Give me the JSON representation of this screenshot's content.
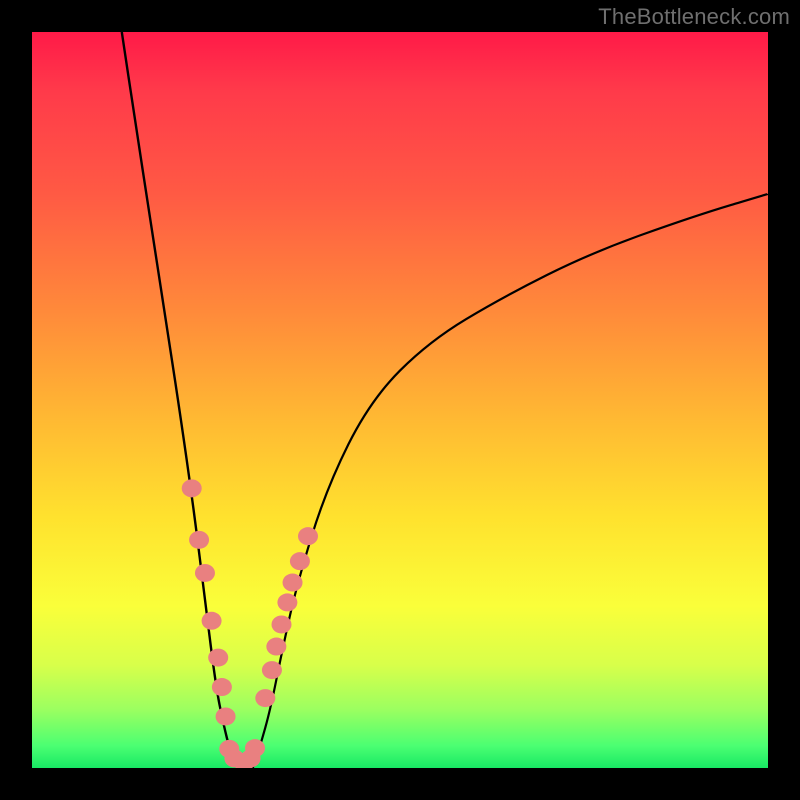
{
  "watermark": "TheBottleneck.com",
  "chart_data": {
    "type": "line",
    "title": "",
    "xlabel": "",
    "ylabel": "",
    "xlim": [
      0,
      100
    ],
    "ylim": [
      0,
      100
    ],
    "grid": false,
    "series": [
      {
        "name": "left-branch",
        "x": [
          12.2,
          14,
          16,
          18,
          20,
          22,
          23.6,
          25,
          26,
          27,
          28
        ],
        "y": [
          100,
          88,
          75,
          62,
          49,
          35,
          22,
          11,
          6,
          2,
          0
        ]
      },
      {
        "name": "right-branch",
        "x": [
          30,
          31,
          32.4,
          34,
          36,
          40,
          46,
          54,
          64,
          76,
          90,
          100
        ],
        "y": [
          0,
          3,
          8,
          16,
          25,
          38,
          50,
          58,
          64,
          70,
          75,
          78
        ]
      }
    ],
    "markers": [
      {
        "name": "left-cluster",
        "x": [
          21.7,
          22.7,
          23.5,
          24.4,
          25.3,
          25.8,
          26.3
        ],
        "y": [
          38,
          31,
          26.5,
          20,
          15,
          11,
          7
        ]
      },
      {
        "name": "bottom-cluster",
        "x": [
          26.8,
          27.5,
          28.8,
          29.7,
          30.3
        ],
        "y": [
          2.6,
          1.3,
          0.7,
          1.3,
          2.7
        ]
      },
      {
        "name": "right-cluster",
        "x": [
          31.7,
          32.6,
          33.2,
          33.9,
          34.7,
          35.4,
          36.4,
          37.5
        ],
        "y": [
          9.5,
          13.3,
          16.5,
          19.5,
          22.5,
          25.2,
          28.1,
          31.5
        ]
      }
    ],
    "colors": {
      "curve": "#000000",
      "markers": "#e98080",
      "background_top": "#ff1a48",
      "background_bottom": "#18e864"
    }
  }
}
